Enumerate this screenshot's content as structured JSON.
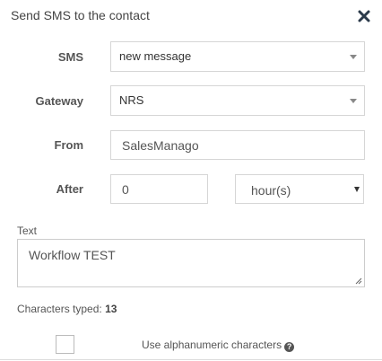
{
  "dialog": {
    "title": "Send SMS to the contact",
    "close_icon": "close-icon"
  },
  "form": {
    "sms": {
      "label": "SMS",
      "value": "new message"
    },
    "gateway": {
      "label": "Gateway",
      "value": "NRS"
    },
    "from": {
      "label": "From",
      "value": "SalesManago"
    },
    "after": {
      "label": "After",
      "value": "0",
      "unit": "hour(s)"
    },
    "text": {
      "label": "Text",
      "value": "Workflow TEST"
    },
    "characters_typed": {
      "label": "Characters typed:",
      "count": "13"
    },
    "alphanumeric": {
      "label": "Use alphanumeric characters",
      "checked": false,
      "help_icon": "question-circle-icon"
    }
  }
}
